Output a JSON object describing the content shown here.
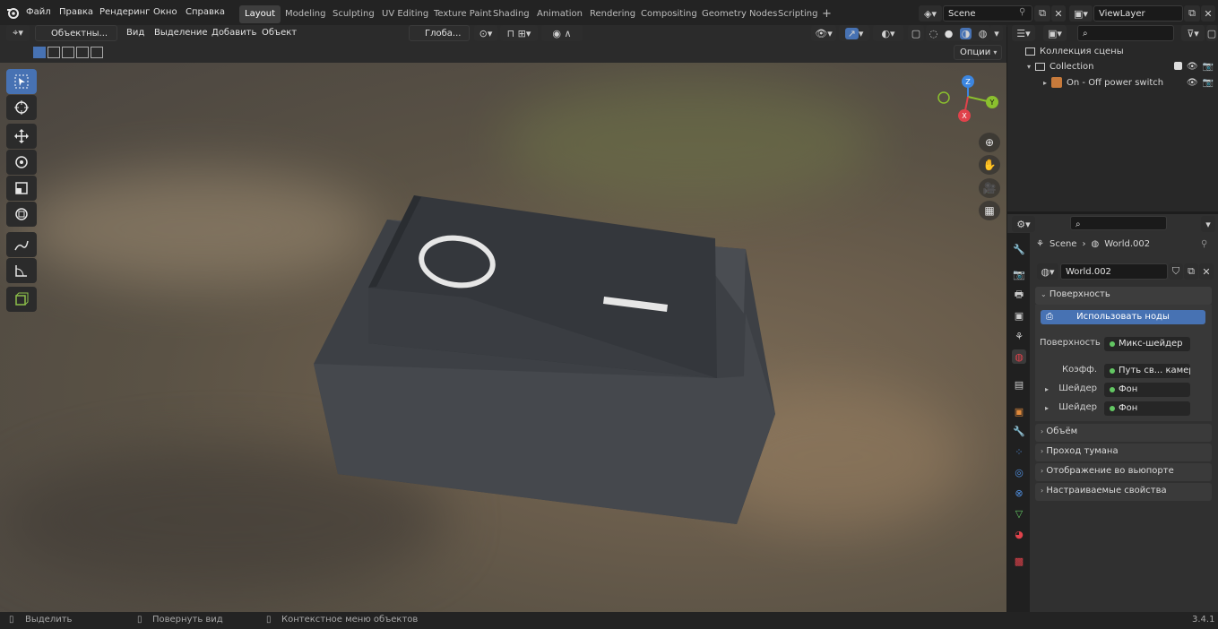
{
  "topbar": {
    "menus": [
      "Файл",
      "Правка",
      "Рендеринг",
      "Окно",
      "Справка"
    ],
    "workspaces": [
      "Layout",
      "Modeling",
      "Sculpting",
      "UV Editing",
      "Texture Paint",
      "Shading",
      "Animation",
      "Rendering",
      "Compositing",
      "Geometry Nodes",
      "Scripting"
    ],
    "active_workspace": "Layout",
    "scene": "Scene",
    "view_layer": "ViewLayer",
    "add_tab": "+"
  },
  "viewport_header": {
    "mode": "Объектны...",
    "menus": [
      "Вид",
      "Выделение",
      "Добавить",
      "Объект"
    ],
    "orientation": "Глоба...",
    "options": "Опции"
  },
  "tools": [
    "select-box",
    "cursor",
    "move",
    "rotate",
    "scale",
    "transform",
    "annotate",
    "measure",
    "add-cube"
  ],
  "gizmo": {
    "z": "Z",
    "y": "Y",
    "x": "X"
  },
  "switch_labels": {
    "off": "O",
    "on": "I"
  },
  "outliner": {
    "scene_collection": "Коллекция сцены",
    "collection": "Collection",
    "object": "On - Off power switch"
  },
  "properties": {
    "breadcrumb_scene": "Scene",
    "breadcrumb_world": "World.002",
    "world_name": "World.002",
    "surface_panel": "Поверхность",
    "use_nodes": "Использовать ноды",
    "rows": [
      {
        "label": "Поверхность",
        "value": "Микс-шейдер",
        "expand": ""
      },
      {
        "label": "Коэфф.",
        "value": "Путь св... камеры",
        "expand": ""
      },
      {
        "label": "Шейдер",
        "value": "Фон",
        "expand": "▸"
      },
      {
        "label": "Шейдер",
        "value": "Фон",
        "expand": "▸"
      }
    ],
    "panels": [
      "Объём",
      "Проход тумана",
      "Отображение во вьюпорте",
      "Настраиваемые свойства"
    ]
  },
  "statusbar": {
    "select": "Выделить",
    "rotate": "Повернуть вид",
    "context": "Контекстное меню объектов",
    "version": "3.4.1"
  },
  "colors": {
    "accent": "#4772b3",
    "active_tool": "#4772b3",
    "x_axis": "#e0424b",
    "y_axis": "#8bc02e",
    "z_axis": "#3c86e0"
  }
}
